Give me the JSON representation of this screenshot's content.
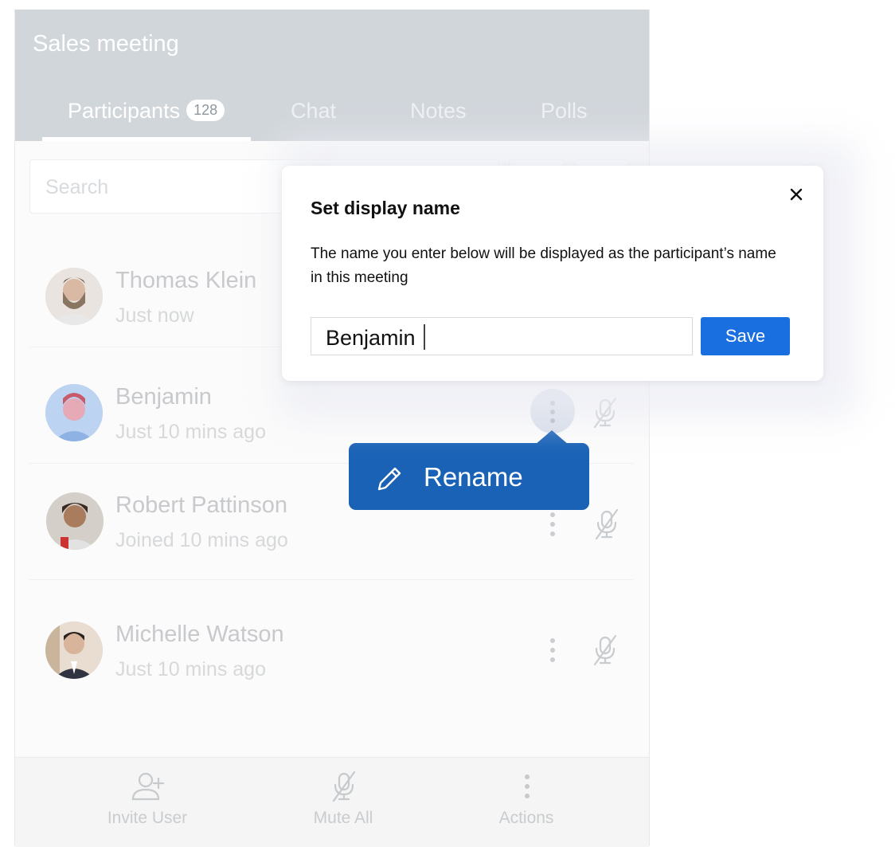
{
  "header": {
    "title": "Sales meeting",
    "tabs": [
      {
        "label": "Participants",
        "badge": "128"
      },
      {
        "label": "Chat"
      },
      {
        "label": "Notes"
      },
      {
        "label": "Polls"
      }
    ]
  },
  "search": {
    "placeholder": "Search"
  },
  "participants": [
    {
      "name": "Thomas Klein",
      "status": "Just now"
    },
    {
      "name": "Benjamin",
      "status": "Just 10 mins ago"
    },
    {
      "name": "Robert Pattinson",
      "status": "Joined 10 mins ago"
    },
    {
      "name": "Michelle Watson",
      "status": "Just 10 mins ago"
    }
  ],
  "menu": {
    "rename_label": "Rename"
  },
  "dialog": {
    "title": "Set display name",
    "description": "The name you enter below will be displayed as the participant’s name in this meeting",
    "input_value": "Benjamin",
    "save_label": "Save"
  },
  "footer": {
    "invite_label": "Invite User",
    "mute_all_label": "Mute All",
    "actions_label": "Actions"
  },
  "colors": {
    "accent": "#1a62b6",
    "save_button": "#1a6fe0",
    "header_bg": "#d1d6db"
  },
  "icons": [
    "person-add-icon",
    "mic-off-icon",
    "more-vertical-icon",
    "pencil-icon",
    "close-icon"
  ]
}
